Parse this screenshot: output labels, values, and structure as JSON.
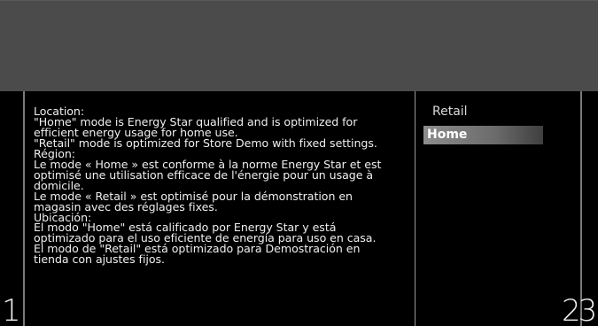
{
  "description_text": "Location:\n\"Home\" mode is Energy Star qualified and is optimized for\nefficient energy usage for home use.\n\"Retail\" mode is optimized for Store Demo with fixed settings.\nRégion:\nLe mode « Home » est conforme à la norme Energy Star et est\noptimisé une utilisation efficace de l'énergie pour un usage à\ndomicile.\nLe mode « Retail » est optimisé pour la démonstration en\nmagasin avec des réglages fixes.\nUbicación:\nEl modo \"Home\" está calificado por Energy Star y está\noptimizado para el uso eficiente de energía para uso en casa.\nEl modo de \"Retail\" está optimizado para Demostración en\ntienda con ajustes fijos.",
  "menu": {
    "items": [
      {
        "label": "Retail",
        "selected": false
      },
      {
        "label": "Home",
        "selected": true
      }
    ]
  },
  "step_labels": {
    "left": "1",
    "right": "23"
  },
  "colors": {
    "top_band": "#4b4b4b",
    "background": "#000000",
    "highlight": "#8d8d8d"
  }
}
